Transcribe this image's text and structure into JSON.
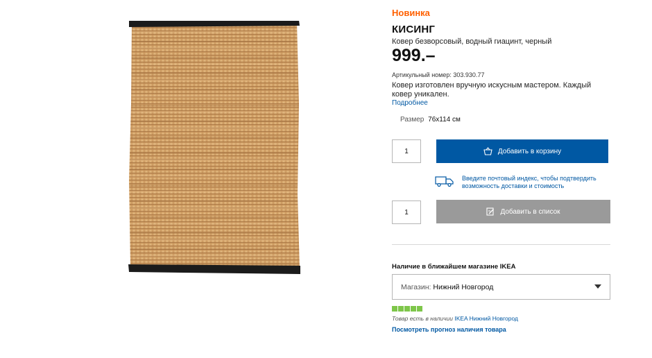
{
  "product_image": {
    "alt": "rug-image"
  },
  "product": {
    "badge": "Новинка",
    "name": "КИСИНГ",
    "description": "Ковер безворсовый, водный гиацинт, черный",
    "price": "999.–",
    "article_label": "Артикульный номер:",
    "article_number": "303.930.77",
    "about": "Ковер изготовлен вручную искусным мастером. Каждый ковер уникален.",
    "more_link": "Подробнее",
    "size_label": "Размер",
    "size_value": "76х114 см"
  },
  "cart": {
    "quantity": "1",
    "add_to_cart": "Добавить в корзину"
  },
  "delivery": {
    "text": "Введите почтовый индекс, чтобы подтвердить возможность доставки и стоимость"
  },
  "list": {
    "quantity": "1",
    "add_to_list": "Добавить в список"
  },
  "store": {
    "heading": "Наличие в ближайшем магазине IKEA",
    "select_prefix": "Магазин:",
    "selected_store": "Нижний Новгород",
    "stock_text": "Товар есть в наличии",
    "stock_store_link": "IKEA Нижний Новгород",
    "forecast_link": "Посмотреть прогноз наличия товара",
    "stock_level": 1.0
  },
  "colors": {
    "accent_blue": "#0058a3",
    "new_orange": "#ff6000",
    "stock_green": "#7ec64a",
    "list_button_gray": "#9a9a9a"
  },
  "icons": {
    "cart_button": "shopping-bag-icon",
    "delivery": "truck-icon",
    "list_button": "shopping-list-icon",
    "select": "caret-down-icon"
  }
}
